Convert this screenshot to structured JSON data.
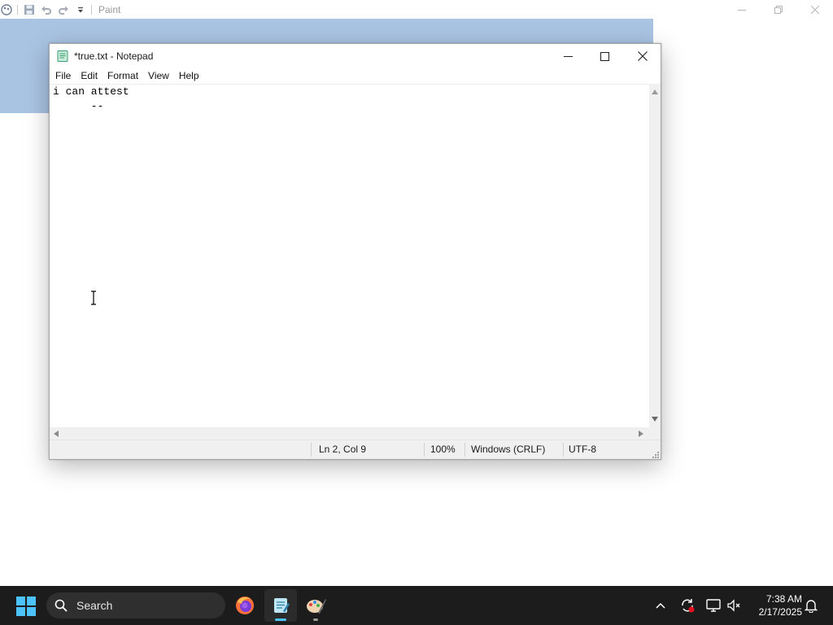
{
  "paint": {
    "title": "Paint",
    "icons": [
      "paint-app-icon",
      "save-icon",
      "undo-icon",
      "redo-icon",
      "customize-quick-access-icon"
    ]
  },
  "notepad": {
    "title": "*true.txt - Notepad",
    "menu": [
      "File",
      "Edit",
      "Format",
      "View",
      "Help"
    ],
    "content_lines": [
      "i can attest",
      "      --"
    ],
    "status": {
      "position": "Ln 2, Col 9",
      "zoom": "100%",
      "line_ending": "Windows (CRLF)",
      "encoding": "UTF-8"
    }
  },
  "taskbar": {
    "search_placeholder": "Search",
    "apps": [
      "firefox-icon",
      "notepad-icon",
      "paint-icon"
    ],
    "active_app": "notepad-icon",
    "tray_icons": [
      "chevron-up-icon",
      "sync-alert-icon",
      "display-icon",
      "volume-muted-icon"
    ],
    "time": "7:38 AM",
    "date": "2/17/2025",
    "notification_icon": "bell-icon"
  },
  "colors": {
    "taskbar_bg": "#1c1c1c",
    "paint_ribbon": "#a9c4e3",
    "accent": "#0078d4",
    "active_indicator": "#4cc2ff"
  }
}
